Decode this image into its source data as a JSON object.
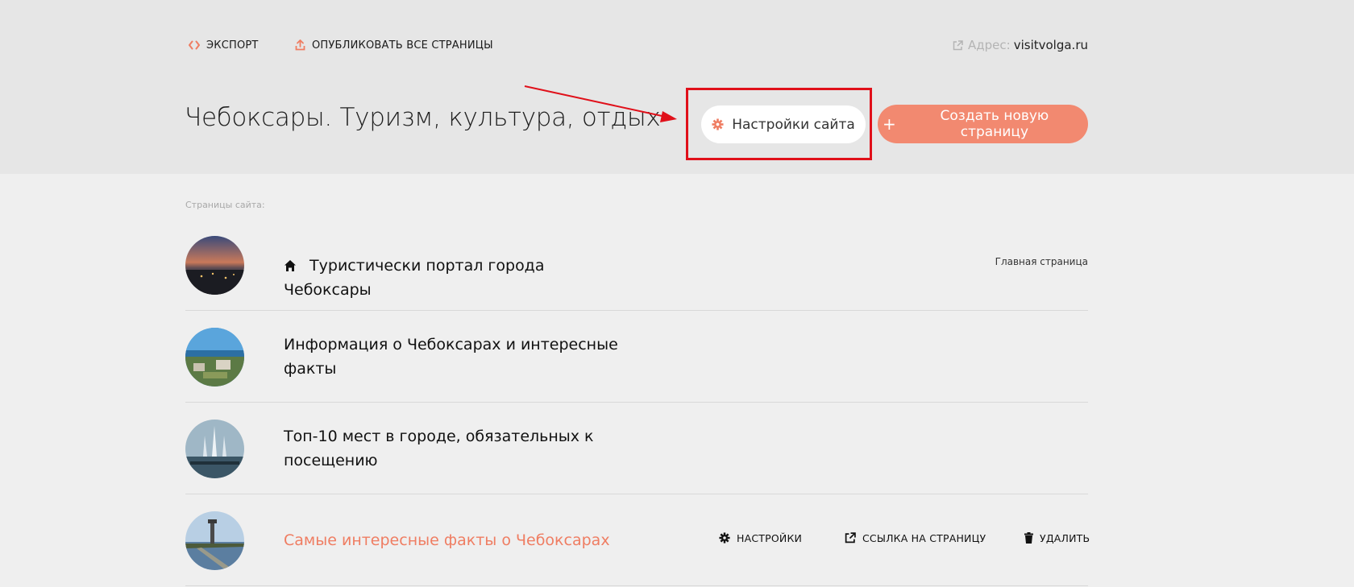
{
  "topbar": {
    "export_label": "ЭКСПОРТ",
    "publish_label": "ОПУБЛИКОВАТЬ ВСЕ СТРАНИЦЫ",
    "address_label": "Адрес:",
    "address_domain": "visitvolga.ru"
  },
  "header": {
    "site_title": "Чебоксары. Туризм, культура, отдых",
    "settings_button": "Настройки сайта",
    "create_button": "Создать новую страницу"
  },
  "pages_section": {
    "label": "Страницы сайта:",
    "pages": [
      {
        "title": "Туристически портал города Чебоксары",
        "meta": "Главная страница",
        "thumb": "city-night"
      },
      {
        "title": "Информация о Чебоксарах и интересные факты",
        "thumb": "river-aerial"
      },
      {
        "title": "Топ-10 мест в городе, обязательных к посещению",
        "thumb": "fountain"
      },
      {
        "title": "Самые интересные факты о Чебоксарах",
        "thumb": "monument-bay"
      }
    ],
    "row_actions": {
      "settings": "НАСТРОЙКИ",
      "link": "ССЫЛКА НА СТРАНИЦУ",
      "delete": "УДАЛИТЬ"
    }
  },
  "colors": {
    "accent": "#f28970",
    "accent_text": "#ef7d62",
    "highlight": "#e0101a",
    "header_bg": "#e6e6e6",
    "body_bg": "#efefef"
  },
  "icons": {
    "export": "code-brackets-icon",
    "publish": "upload-icon",
    "address": "external-link-icon",
    "settings": "gear-icon",
    "create": "plus-icon",
    "home": "home-icon",
    "link": "external-link-icon",
    "delete": "trash-icon"
  }
}
